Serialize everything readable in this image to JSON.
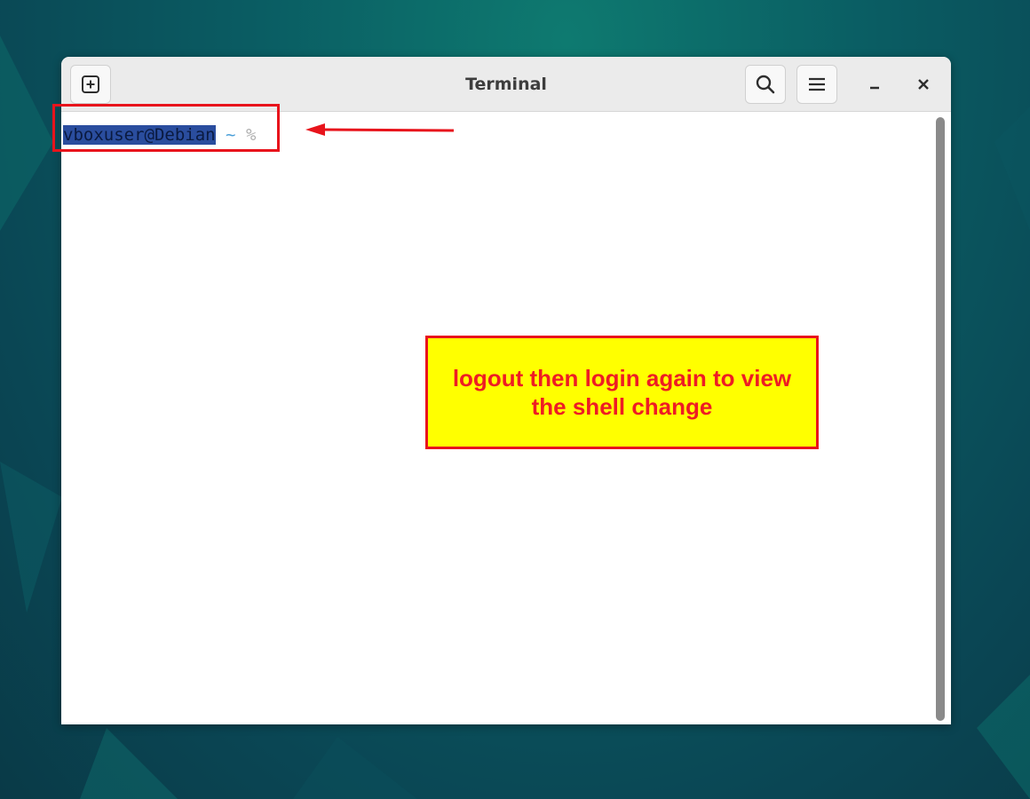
{
  "window": {
    "title": "Terminal"
  },
  "icons": {
    "new_tab": "plus-square-icon",
    "search": "search-icon",
    "menu": "hamburger-menu-icon",
    "minimize": "minimize-icon",
    "close": "close-icon"
  },
  "terminal": {
    "prompt_user": "vboxuser@Debian",
    "prompt_dir": "~",
    "prompt_symbol": "%"
  },
  "annotation": {
    "note": "logout then login again to view the shell change"
  },
  "colors": {
    "selection": "#2a4d9e",
    "annotation_red": "#e8141c",
    "note_background": "#ffff00"
  }
}
